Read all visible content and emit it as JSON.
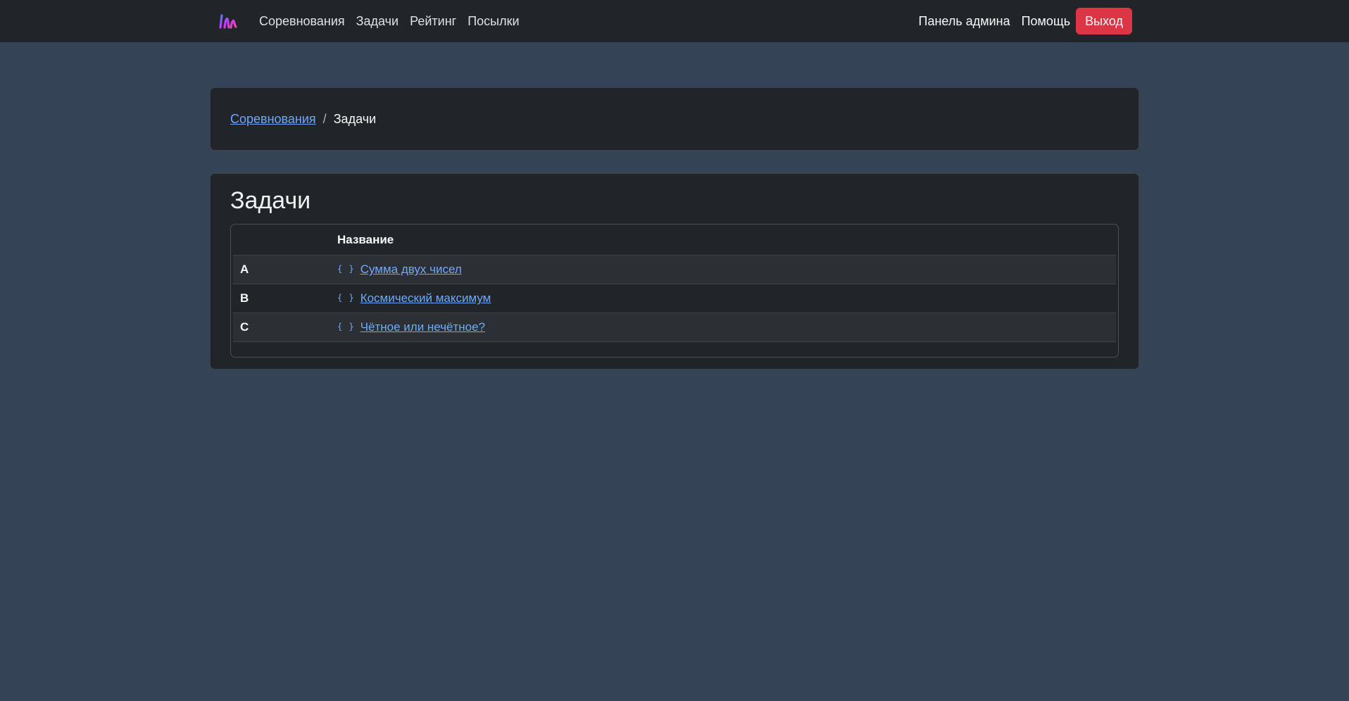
{
  "navbar": {
    "logo": "logo-icon",
    "left_items": [
      {
        "label": "Соревнования"
      },
      {
        "label": "Задачи"
      },
      {
        "label": "Рейтинг"
      },
      {
        "label": "Посылки"
      }
    ],
    "right_items": [
      {
        "label": "Панель админа"
      },
      {
        "label": "Помощь"
      }
    ],
    "logout_label": "Выход"
  },
  "breadcrumb": {
    "parent": "Соревнования",
    "separator": "/",
    "current": "Задачи"
  },
  "main": {
    "title": "Задачи",
    "table": {
      "columns": [
        "",
        "Название"
      ],
      "rows": [
        {
          "letter": "A",
          "icon": "code-braces-icon",
          "name": "Сумма двух чисел"
        },
        {
          "letter": "B",
          "icon": "code-braces-icon",
          "name": "Космический максимум"
        },
        {
          "letter": "C",
          "icon": "code-braces-icon",
          "name": "Чётное или нечётное?"
        }
      ]
    }
  },
  "colors": {
    "page_bg": "#344355",
    "navbar_bg": "#212529",
    "card_bg": "#212529",
    "link": "#6ea8fe",
    "danger": "#dc3545"
  }
}
